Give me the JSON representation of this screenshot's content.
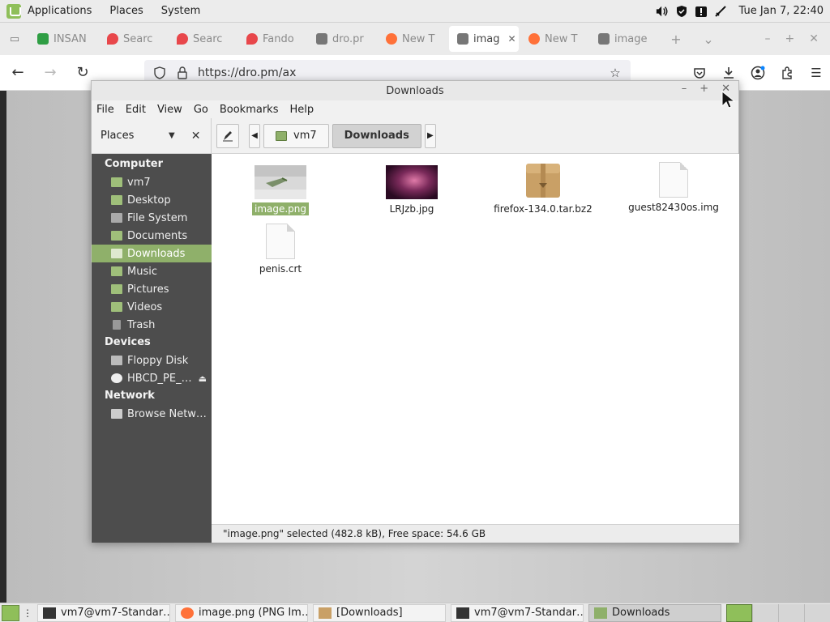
{
  "top_panel": {
    "menus": [
      "Applications",
      "Places",
      "System"
    ],
    "clock": "Tue Jan  7, 22:40"
  },
  "browser": {
    "tabs": [
      {
        "label": "INSAN",
        "favicon_color": "#2f9e44"
      },
      {
        "label": "Searc",
        "favicon_color": "#e8474b"
      },
      {
        "label": "Searc",
        "favicon_color": "#e8474b"
      },
      {
        "label": "Fando",
        "favicon_color": "#e8474b"
      },
      {
        "label": "dro.pr",
        "favicon_color": "#777777"
      },
      {
        "label": "New T",
        "favicon_color": "#ff7139"
      },
      {
        "label": "imag",
        "favicon_color": "#777777",
        "active": true
      },
      {
        "label": "New T",
        "favicon_color": "#ff7139"
      },
      {
        "label": "image",
        "favicon_color": "#777777"
      }
    ],
    "url": "https://dro.pm/ax",
    "accent_color": "#0a84ff"
  },
  "file_manager": {
    "title": "Downloads",
    "menu": [
      "File",
      "Edit",
      "View",
      "Go",
      "Bookmarks",
      "Help"
    ],
    "places_label": "Places",
    "breadcrumbs": [
      {
        "label": "vm7",
        "icon": "home-folder-icon"
      },
      {
        "label": "Downloads",
        "active": true
      }
    ],
    "sidebar": {
      "sections": [
        {
          "heading": "Computer",
          "items": [
            {
              "label": "vm7",
              "icon": "home-folder-icon"
            },
            {
              "label": "Desktop",
              "icon": "desktop-icon"
            },
            {
              "label": "File System",
              "icon": "drive-icon"
            },
            {
              "label": "Documents",
              "icon": "folder-icon"
            },
            {
              "label": "Downloads",
              "icon": "folder-icon",
              "selected": true
            },
            {
              "label": "Music",
              "icon": "folder-icon"
            },
            {
              "label": "Pictures",
              "icon": "folder-icon"
            },
            {
              "label": "Videos",
              "icon": "folder-icon"
            },
            {
              "label": "Trash",
              "icon": "trash-icon"
            }
          ]
        },
        {
          "heading": "Devices",
          "items": [
            {
              "label": "Floppy Disk",
              "icon": "floppy-icon"
            },
            {
              "label": "HBCD_PE_…",
              "icon": "disc-icon",
              "eject": true
            }
          ]
        },
        {
          "heading": "Network",
          "items": [
            {
              "label": "Browse Netw…",
              "icon": "network-icon"
            }
          ]
        }
      ]
    },
    "files": [
      {
        "name": "image.png",
        "type": "image",
        "selected": true
      },
      {
        "name": "LRJzb.jpg",
        "type": "image"
      },
      {
        "name": "firefox-134.0.tar.bz2",
        "type": "archive"
      },
      {
        "name": "guest82430os.img",
        "type": "document"
      },
      {
        "name": "penis.crt",
        "type": "document"
      }
    ],
    "status": "\"image.png\" selected (482.8 kB), Free space: 54.6 GB",
    "selection_color": "#8fb06a"
  },
  "taskbar": {
    "tasks": [
      {
        "label": "vm7@vm7-Standar…",
        "icon": "terminal-icon"
      },
      {
        "label": "image.png (PNG Im…",
        "icon": "firefox-icon"
      },
      {
        "label": "[Downloads]",
        "icon": "folder-icon"
      },
      {
        "label": "vm7@vm7-Standar…",
        "icon": "terminal-icon"
      },
      {
        "label": "Downloads",
        "icon": "folder-icon",
        "active": true
      }
    ]
  }
}
